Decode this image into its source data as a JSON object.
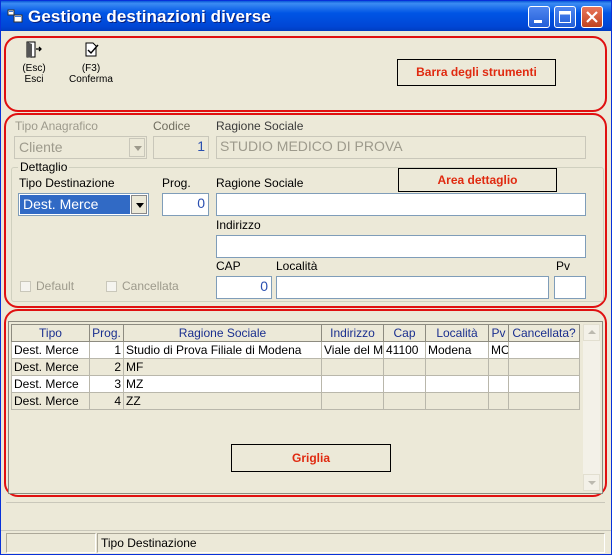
{
  "window": {
    "title": "Gestione destinazioni diverse",
    "colors": {
      "titlebar": "#0055e5",
      "annotation_border": "#e01010",
      "annotation_text": "#e02a10",
      "selection": "#316ac5"
    }
  },
  "toolbar": {
    "esc_key": "(Esc)",
    "esc_label": "Esci",
    "confirm_key": "(F3)",
    "confirm_label": "Conferma"
  },
  "annotations": {
    "toolbar": "Barra degli strumenti",
    "detail": "Area dettaglio",
    "grid": "Griglia"
  },
  "header": {
    "tipo_anagrafico_label": "Tipo Anagrafico",
    "tipo_anagrafico_value": "Cliente",
    "codice_label": "Codice",
    "codice_value": "1",
    "ragione_sociale_label": "Ragione Sociale",
    "ragione_sociale_value": "STUDIO MEDICO DI PROVA"
  },
  "detail": {
    "group_label": "Dettaglio",
    "tipo_destinazione_label": "Tipo Destinazione",
    "tipo_destinazione_value": "Dest. Merce",
    "prog_label": "Prog.",
    "prog_value": "0",
    "ragione_sociale_label": "Ragione Sociale",
    "ragione_sociale_value": "",
    "indirizzo_label": "Indirizzo",
    "indirizzo_value": "",
    "cap_label": "CAP",
    "cap_value": "0",
    "localita_label": "Località",
    "localita_value": "",
    "pv_label": "Pv",
    "pv_value": "",
    "default_label": "Default",
    "default_checked": false,
    "cancellata_label": "Cancellata",
    "cancellata_checked": false
  },
  "grid": {
    "columns": [
      "Tipo",
      "Prog.",
      "Ragione Sociale",
      "Indirizzo",
      "Cap",
      "Località",
      "Pv",
      "Cancellata?"
    ],
    "rows": [
      [
        "Dest. Merce",
        "1",
        "Studio di Prova Filiale di Modena",
        "Viale del M",
        "41100",
        "Modena",
        "MO",
        ""
      ],
      [
        "Dest. Merce",
        "2",
        "MF",
        "",
        "",
        "",
        "",
        ""
      ],
      [
        "Dest. Merce",
        "3",
        "MZ",
        "",
        "",
        "",
        "",
        ""
      ],
      [
        "Dest. Merce",
        "4",
        "ZZ",
        "",
        "",
        "",
        "",
        ""
      ]
    ]
  },
  "status": {
    "left": "",
    "right": "Tipo Destinazione"
  }
}
